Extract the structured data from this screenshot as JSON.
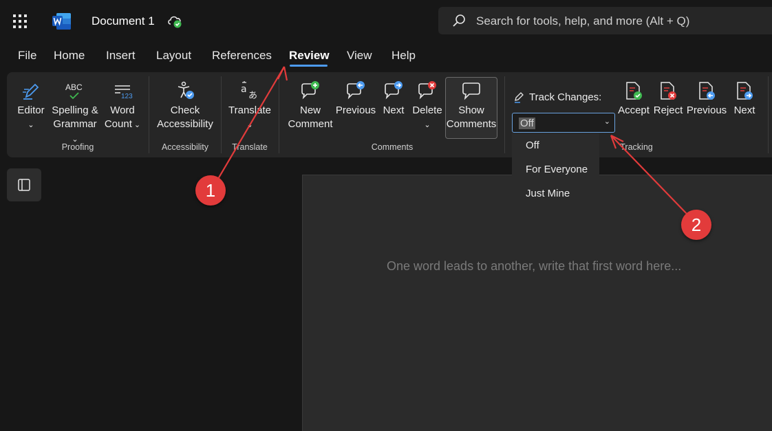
{
  "app": {
    "document_title": "Document 1",
    "search_placeholder": "Search for tools, help, and more (Alt + Q)"
  },
  "menu": {
    "tabs": [
      {
        "label": "File"
      },
      {
        "label": "Home"
      },
      {
        "label": "Insert"
      },
      {
        "label": "Layout"
      },
      {
        "label": "References"
      },
      {
        "label": "Review",
        "active": true
      },
      {
        "label": "View"
      },
      {
        "label": "Help"
      }
    ]
  },
  "ribbon": {
    "proofing": {
      "editor_line1": "Editor",
      "spelling_line1": "Spelling &",
      "spelling_line2": "Grammar",
      "wordcount_line1": "Word",
      "wordcount_line2": "Count",
      "spelling_icon_text": "ABC",
      "wordcount_icon_text": "123",
      "group_label": "Proofing"
    },
    "accessibility": {
      "line1": "Check",
      "line2": "Accessibility",
      "group_label": "Accessibility"
    },
    "translate": {
      "label": "Translate",
      "group_label": "Translate"
    },
    "comments": {
      "new_line1": "New",
      "new_line2": "Comment",
      "previous": "Previous",
      "next": "Next",
      "delete": "Delete",
      "show_line1": "Show",
      "show_line2": "Comments",
      "group_label": "Comments"
    },
    "tracking": {
      "track_changes_label": "Track Changes:",
      "selected_value": "Off",
      "accept": "Accept",
      "reject": "Reject",
      "previous": "Previous",
      "next": "Next",
      "group_label": "Tracking",
      "options": [
        "Off",
        "For Everyone",
        "Just Mine"
      ]
    }
  },
  "document": {
    "placeholder": "One word leads to another, write that first word here..."
  },
  "annotations": {
    "badge1": "1",
    "badge2": "2"
  },
  "colors": {
    "accent": "#4d9bf0",
    "annotation_red": "#e23b3b",
    "background": "#171717",
    "ribbon": "#262626"
  }
}
